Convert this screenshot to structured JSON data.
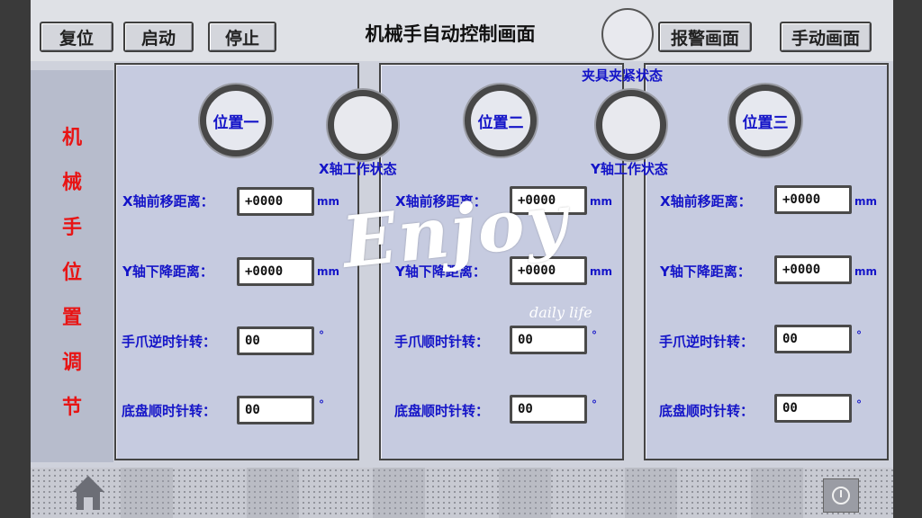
{
  "header": {
    "title": "机械手自动控制画面",
    "buttons": {
      "reset": "复位",
      "start": "启动",
      "stop": "停止",
      "alarm_screen": "报警画面",
      "manual_screen": "手动画面"
    },
    "clamp_status_label": "夹具夹紧状态"
  },
  "side_title": "机械手位置调节",
  "status_labels": {
    "x_axis": "X轴工作状态",
    "y_axis": "Y轴工作状态"
  },
  "panels": [
    {
      "position_label": "位置一",
      "rows": [
        {
          "label": "X轴前移距离：",
          "value": "+0000",
          "unit": "mm"
        },
        {
          "label": "Y轴下降距离：",
          "value": "+0000",
          "unit": "mm"
        },
        {
          "label": "手爪逆时针转：",
          "value": "00",
          "unit": "°"
        },
        {
          "label": "底盘顺时针转：",
          "value": "00",
          "unit": "°"
        }
      ]
    },
    {
      "position_label": "位置二",
      "rows": [
        {
          "label": "X轴前移距离：",
          "value": "+0000",
          "unit": "mm"
        },
        {
          "label": "Y轴下降距离：",
          "value": "+0000",
          "unit": "mm"
        },
        {
          "label": "手爪顺时针转：",
          "value": "00",
          "unit": "°"
        },
        {
          "label": "底盘顺时针转：",
          "value": "00",
          "unit": "°"
        }
      ]
    },
    {
      "position_label": "位置三",
      "rows": [
        {
          "label": "X轴前移距离：",
          "value": "+0000",
          "unit": "mm"
        },
        {
          "label": "Y轴下降距离：",
          "value": "+0000",
          "unit": "mm"
        },
        {
          "label": "手爪逆时针转：",
          "value": "00",
          "unit": "°"
        },
        {
          "label": "底盘顺时针转：",
          "value": "00",
          "unit": "°"
        }
      ]
    }
  ],
  "watermark": {
    "main": "Enjoy",
    "sub": "daily life"
  },
  "icons": {
    "home": "home-icon",
    "power": "power-icon"
  },
  "colors": {
    "label_blue": "#1414c8",
    "title_red": "#e81414",
    "panel_bg": "#c6cbe0"
  }
}
